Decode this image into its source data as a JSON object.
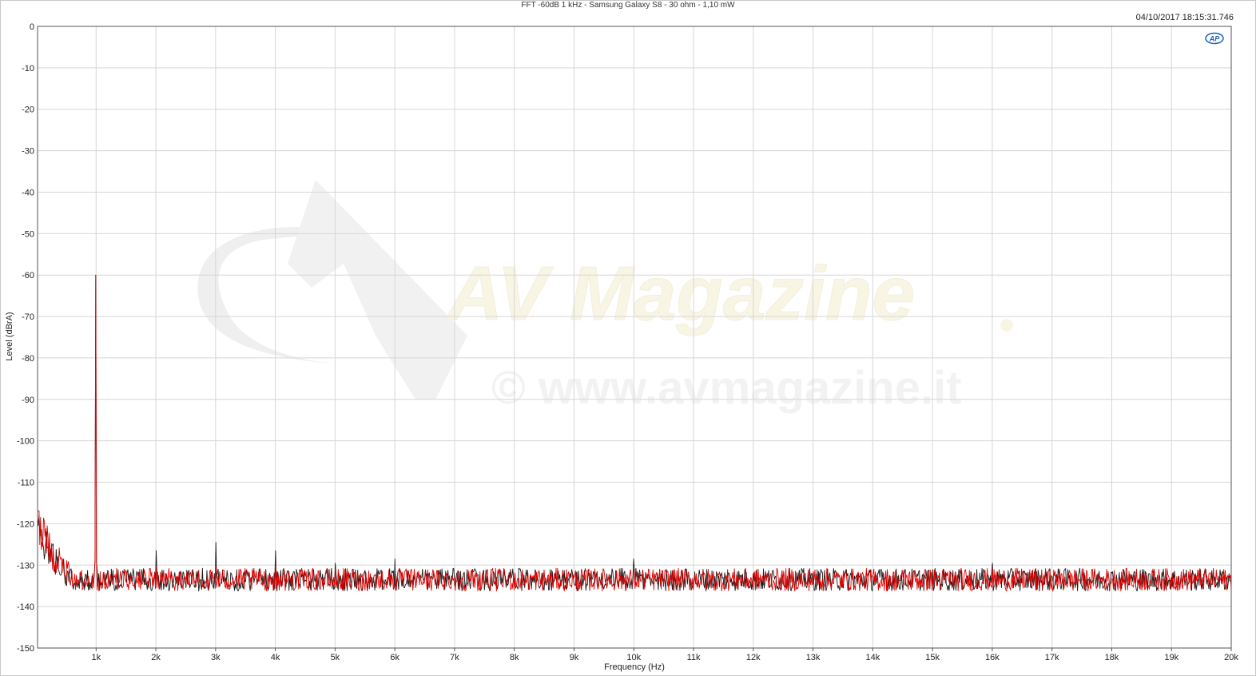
{
  "title": "FFT -60dB 1 kHz - Samsung Galaxy S8 - 30 ohm - 1,10 mW",
  "timestamp": "04/10/2017 18:15:31.746",
  "logo_text": "AP",
  "watermark": {
    "brand": "AV Magazine",
    "url_text": "© www.avmagazine.it"
  },
  "colors": {
    "grid": "#d6d6d6",
    "axis": "#555555",
    "series_black": "#1a1a1a",
    "series_red": "#e00000",
    "logo": "#1a5fb4"
  },
  "chart_data": {
    "type": "line",
    "title": "FFT -60dB 1 kHz - Samsung Galaxy S8 - 30 ohm - 1,10 mW",
    "xlabel": "Frequency (Hz)",
    "ylabel": "Level (dBrA)",
    "xlim": [
      20,
      20000
    ],
    "ylim": [
      -150,
      0
    ],
    "grid": true,
    "x_ticks": [
      1000,
      2000,
      3000,
      4000,
      5000,
      6000,
      7000,
      8000,
      9000,
      10000,
      11000,
      12000,
      13000,
      14000,
      15000,
      16000,
      17000,
      18000,
      19000,
      20000
    ],
    "x_tick_labels": [
      "1k",
      "2k",
      "3k",
      "4k",
      "5k",
      "6k",
      "7k",
      "8k",
      "9k",
      "10k",
      "11k",
      "12k",
      "13k",
      "14k",
      "15k",
      "16k",
      "17k",
      "18k",
      "19k",
      "20k"
    ],
    "y_ticks": [
      0,
      -10,
      -20,
      -30,
      -40,
      -50,
      -60,
      -70,
      -80,
      -90,
      -100,
      -110,
      -120,
      -130,
      -140,
      -150
    ],
    "series": [
      {
        "color": "#1a1a1a",
        "noise_floor": -133.5,
        "low_freq_start": -121,
        "peaks": [
          [
            1000,
            -60
          ],
          [
            2000,
            -126.5
          ],
          [
            3000,
            -124.5
          ],
          [
            4000,
            -126.5
          ],
          [
            5000,
            -129.5
          ],
          [
            6000,
            -128.5
          ],
          [
            10000,
            -128.5
          ],
          [
            16000,
            -129.5
          ]
        ]
      },
      {
        "color": "#e00000",
        "noise_floor": -133.5,
        "low_freq_start": -120,
        "peaks": [
          [
            1000,
            -60
          ],
          [
            2000,
            -130.5
          ],
          [
            3000,
            -130
          ],
          [
            4000,
            -130
          ]
        ]
      }
    ]
  }
}
